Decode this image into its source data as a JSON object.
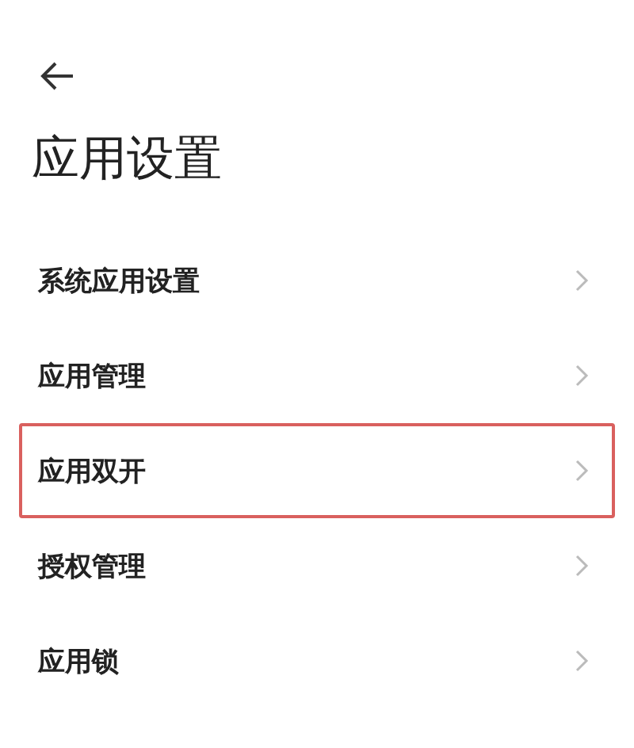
{
  "title": "应用设置",
  "items": [
    {
      "label": "系统应用设置",
      "highlighted": false
    },
    {
      "label": "应用管理",
      "highlighted": false
    },
    {
      "label": "应用双开",
      "highlighted": true
    },
    {
      "label": "授权管理",
      "highlighted": false
    },
    {
      "label": "应用锁",
      "highlighted": false
    }
  ]
}
